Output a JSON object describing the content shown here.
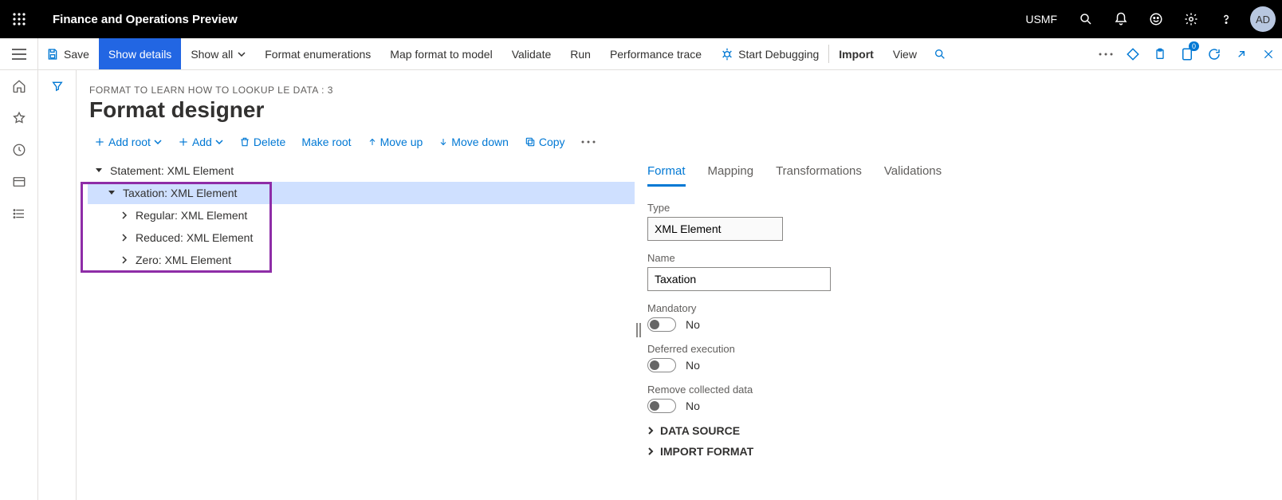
{
  "topbar": {
    "app_title": "Finance and Operations Preview",
    "environment": "USMF",
    "avatar_initials": "AD",
    "notification_count": "0"
  },
  "actionbar": {
    "save": "Save",
    "show_details": "Show details",
    "show_all": "Show all",
    "format_enums": "Format enumerations",
    "map_format": "Map format to model",
    "validate": "Validate",
    "run": "Run",
    "perf_trace": "Performance trace",
    "start_debug": "Start Debugging",
    "import": "Import",
    "view": "View"
  },
  "page": {
    "breadcrumb": "FORMAT TO LEARN HOW TO LOOKUP LE DATA : 3",
    "title": "Format designer"
  },
  "toolbar": {
    "add_root": "Add root",
    "add": "Add",
    "delete": "Delete",
    "make_root": "Make root",
    "move_up": "Move up",
    "move_down": "Move down",
    "copy": "Copy"
  },
  "tree": {
    "n0": "Statement: XML Element",
    "n1": "Taxation: XML Element",
    "n2": "Regular: XML Element",
    "n3": "Reduced: XML Element",
    "n4": "Zero: XML Element"
  },
  "tabs": {
    "format": "Format",
    "mapping": "Mapping",
    "transformations": "Transformations",
    "validations": "Validations"
  },
  "detail": {
    "type_label": "Type",
    "type_value": "XML Element",
    "name_label": "Name",
    "name_value": "Taxation",
    "mandatory_label": "Mandatory",
    "mandatory_value": "No",
    "deferred_label": "Deferred execution",
    "deferred_value": "No",
    "remove_label": "Remove collected data",
    "remove_value": "No",
    "section_ds": "DATA SOURCE",
    "section_import": "IMPORT FORMAT"
  }
}
